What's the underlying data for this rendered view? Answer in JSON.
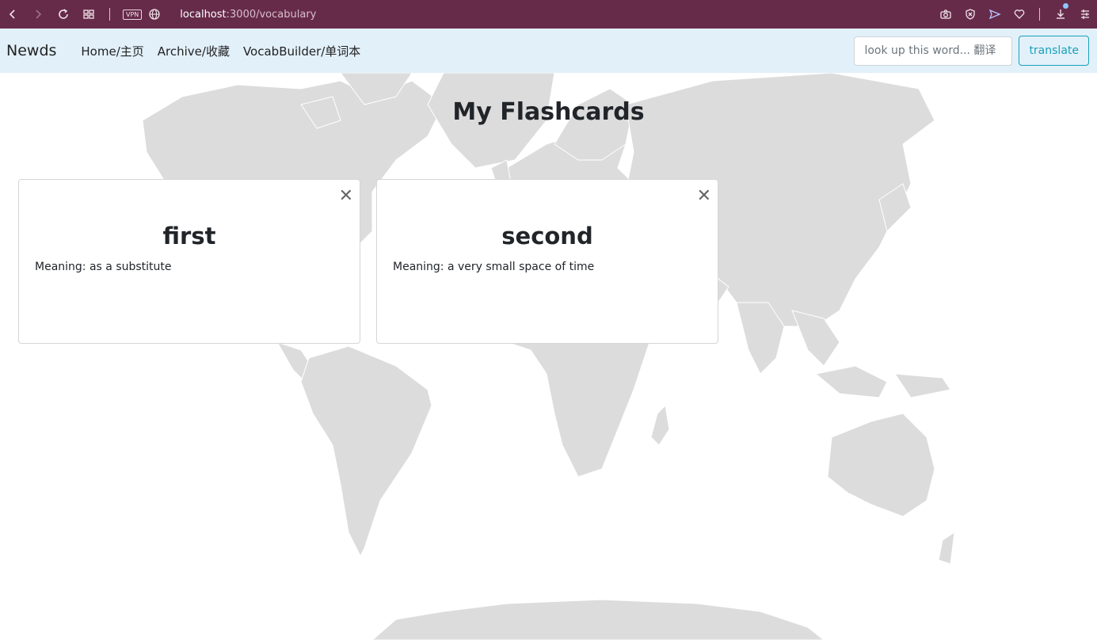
{
  "browser": {
    "url_host": "localhost",
    "url_path": ":3000/vocabulary",
    "vpn_label": "VPN"
  },
  "navbar": {
    "brand": "Newds",
    "links": [
      {
        "label": "Home/主页"
      },
      {
        "label": "Archive/收藏"
      },
      {
        "label": "VocabBuilder/单词本"
      }
    ],
    "search_placeholder": "look up this word... 翻译",
    "translate_label": "translate"
  },
  "page": {
    "title": "My Flashcards"
  },
  "cards": [
    {
      "word": "first",
      "meaning": "Meaning: as a substitute",
      "close": "✕"
    },
    {
      "word": "second",
      "meaning": "Meaning: a very small space of time",
      "close": "✕"
    }
  ],
  "colors": {
    "browser_bar": "#672b4a",
    "navbar": "#e2f0fa",
    "accent": "#17a2b8",
    "map_land": "#dcdcdc"
  }
}
